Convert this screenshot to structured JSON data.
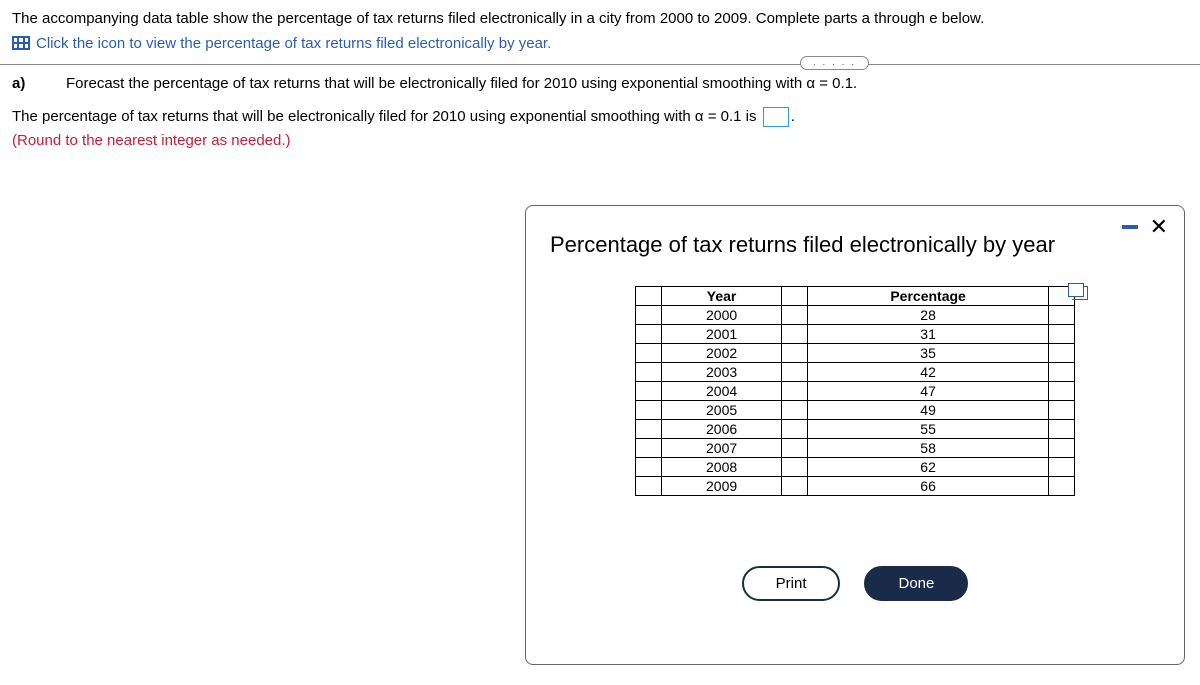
{
  "header": {
    "intro": "The accompanying data table show the percentage of tax returns filed electronically in a city from 2000 to 2009. Complete parts a through e below.",
    "link": "Click the icon to view the percentage of tax returns filed electronically by year.",
    "dots": ". . . . ."
  },
  "question": {
    "part_label": "a)",
    "prompt": "Forecast the percentage of tax returns that will be electronically filed for 2010 using exponential smoothing with α = 0.1.",
    "answer_pre": "The percentage of tax returns that will be electronically filed for 2010 using exponential smoothing with α = 0.1 is ",
    "answer_post": ".",
    "instruction": "(Round to the nearest integer as needed.)"
  },
  "modal": {
    "title": "Percentage of tax returns filed electronically by year",
    "headers": {
      "year": "Year",
      "percentage": "Percentage"
    },
    "print": "Print",
    "done": "Done"
  },
  "chart_data": {
    "type": "table",
    "title": "Percentage of tax returns filed electronically by year",
    "xlabel": "Year",
    "ylabel": "Percentage",
    "categories": [
      2000,
      2001,
      2002,
      2003,
      2004,
      2005,
      2006,
      2007,
      2008,
      2009
    ],
    "values": [
      28,
      31,
      35,
      42,
      47,
      49,
      55,
      58,
      62,
      66
    ]
  }
}
